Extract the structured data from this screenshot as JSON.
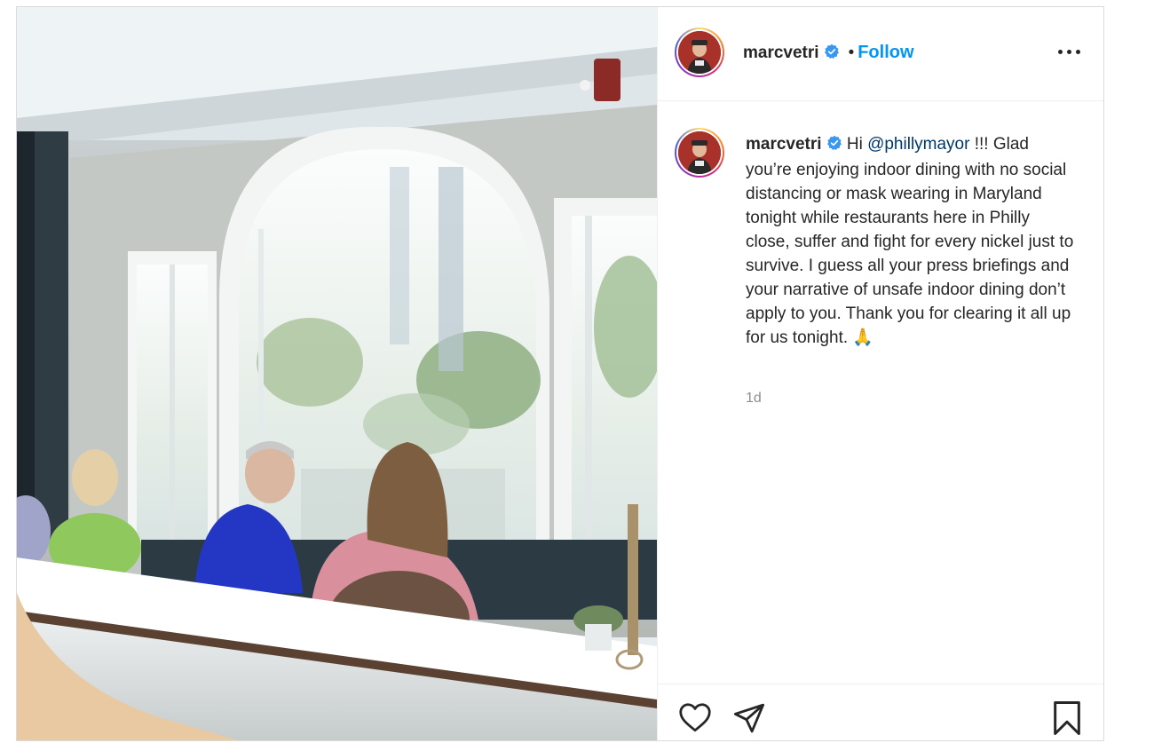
{
  "post": {
    "username": "marcvetri",
    "follow_label": "Follow",
    "separator": "•",
    "caption_prefix": "Hi ",
    "caption_mention": "@phillymayor",
    "caption_text": " !!! Glad you’re enjoying indoor dining with no social distancing or mask wearing in Maryland tonight while restaurants here in Philly close, suffer and fight for every nickel just to survive. I guess all your press briefings and your narrative of unsafe indoor dining don’t apply to you. Thank you for clearing it all up for us tonight. 🙏",
    "timestamp": "1d"
  },
  "icons": {
    "verified": "verified-badge-icon",
    "more": "more-options-icon",
    "like": "heart-icon",
    "share": "paper-plane-icon",
    "save": "bookmark-icon"
  },
  "colors": {
    "follow": "#0095f6",
    "verified": "#3897f0",
    "mention": "#00376b",
    "muted": "#8e8e8e",
    "text": "#262626"
  }
}
